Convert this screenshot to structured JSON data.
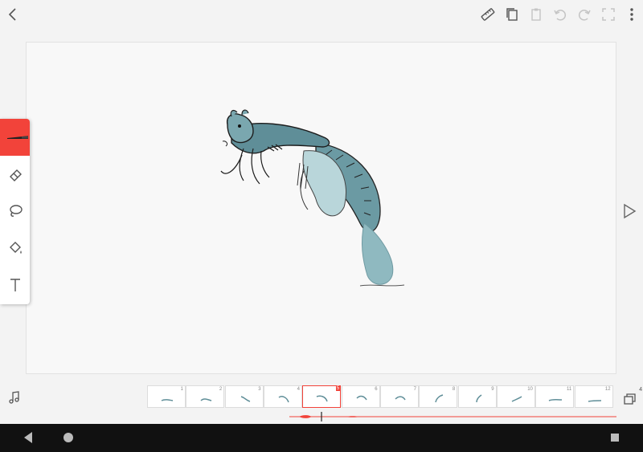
{
  "app": {
    "accent_color": "#f2433a",
    "icons": {
      "back": "chevron-left-icon",
      "ruler": "ruler-icon",
      "copy": "copy-icon",
      "paste": "clipboard-icon",
      "undo": "undo-icon",
      "redo": "redo-icon",
      "fullscreen": "fullscreen-icon",
      "more": "more-vertical-icon",
      "play": "play-icon",
      "audio": "music-note-icon",
      "layers": "layers-icon"
    }
  },
  "tools": [
    {
      "name": "brush",
      "active": true
    },
    {
      "name": "eraser",
      "active": false
    },
    {
      "name": "lasso",
      "active": false
    },
    {
      "name": "fill",
      "active": false
    },
    {
      "name": "text",
      "active": false
    }
  ],
  "timeline": {
    "current_frame": 5,
    "frames": [
      "1",
      "2",
      "3",
      "4",
      "5",
      "6",
      "7",
      "8",
      "9",
      "10",
      "11",
      "12"
    ]
  },
  "layers": {
    "count": "4"
  }
}
